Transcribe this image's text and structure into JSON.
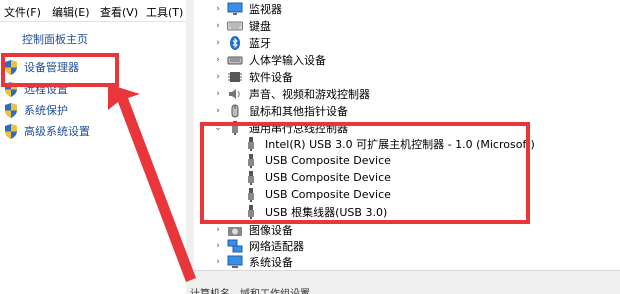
{
  "left_window": {
    "menu": [
      "文件(F)",
      "编辑(E)",
      "查看(V)",
      "工具(T)"
    ],
    "home_link": "控制面板主页",
    "side_links": [
      {
        "label": "设备管理器",
        "icon": "shield-icon"
      },
      {
        "label": "远程设置",
        "icon": "shield-icon"
      },
      {
        "label": "系统保护",
        "icon": "shield-icon"
      },
      {
        "label": "高级系统设置",
        "icon": "shield-icon"
      }
    ],
    "bottom_text": "计算机名、域和工作组设置"
  },
  "device_tree": {
    "categories_top": [
      {
        "label": "监视器",
        "icon": "monitor-icon",
        "expanded": false
      },
      {
        "label": "键盘",
        "icon": "keyboard-icon",
        "expanded": false
      },
      {
        "label": "蓝牙",
        "icon": "bluetooth-icon",
        "expanded": false
      },
      {
        "label": "人体学输入设备",
        "icon": "hid-icon",
        "expanded": false
      },
      {
        "label": "软件设备",
        "icon": "software-device-icon",
        "expanded": false
      },
      {
        "label": "声音、视频和游戏控制器",
        "icon": "speaker-icon",
        "expanded": false
      },
      {
        "label": "鼠标和其他指针设备",
        "icon": "mouse-icon",
        "expanded": false
      }
    ],
    "usb_category": {
      "label": "通用串行总线控制器",
      "icon": "usb-icon",
      "expanded": true
    },
    "usb_children": [
      "Intel(R) USB 3.0 可扩展主机控制器 - 1.0 (Microsoft)",
      "USB Composite Device",
      "USB Composite Device",
      "USB Composite Device",
      "USB 根集线器(USB 3.0)"
    ],
    "categories_bottom": [
      {
        "label": "图像设备",
        "icon": "camera-icon",
        "expanded": false
      },
      {
        "label": "网络适配器",
        "icon": "network-icon",
        "expanded": false
      },
      {
        "label": "系统设备",
        "icon": "system-device-icon",
        "expanded": false
      }
    ]
  },
  "colors": {
    "annotation_red": "#e8363a",
    "link_blue": "#1e4e9a"
  }
}
